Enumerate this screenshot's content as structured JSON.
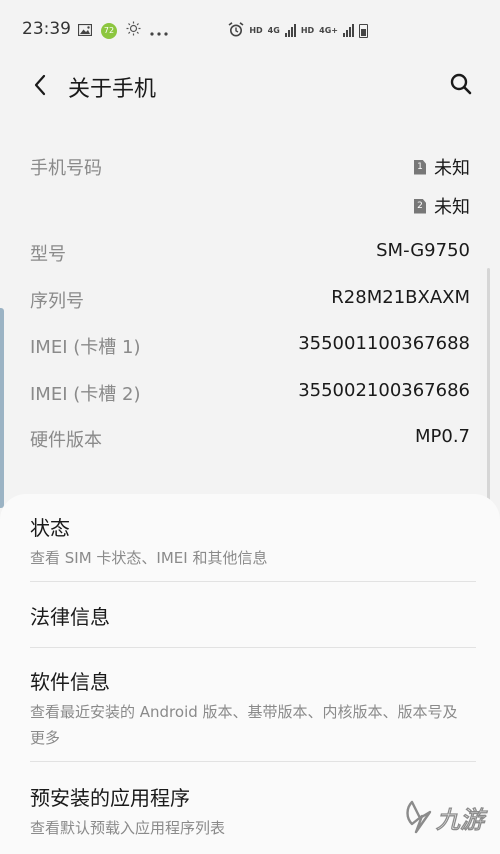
{
  "status_bar": {
    "time": "23:39",
    "badge": "72",
    "hd1": "HD",
    "net1": "4G",
    "hd2": "HD",
    "net2": "4G+"
  },
  "header": {
    "title": "关于手机"
  },
  "info": {
    "phone_label": "手机号码",
    "sim1_num": "1",
    "sim1_value": "未知",
    "sim2_num": "2",
    "sim2_value": "未知",
    "model_label": "型号",
    "model_value": "SM-G9750",
    "serial_label": "序列号",
    "serial_value": "R28M21BXAXM",
    "imei1_label": "IMEI (卡槽 1)",
    "imei1_value": "355001100367688",
    "imei2_label": "IMEI (卡槽 2)",
    "imei2_value": "355002100367686",
    "hw_label": "硬件版本",
    "hw_value": "MP0.7"
  },
  "menu": [
    {
      "title": "状态",
      "subtitle": "查看 SIM 卡状态、IMEI 和其他信息"
    },
    {
      "title": "法律信息",
      "subtitle": ""
    },
    {
      "title": "软件信息",
      "subtitle": "查看最近安装的 Android 版本、基带版本、内核版本、版本号及更多"
    },
    {
      "title": "预安装的应用程序",
      "subtitle": "查看默认预载入应用程序列表"
    }
  ],
  "watermark": {
    "text": "九游"
  }
}
